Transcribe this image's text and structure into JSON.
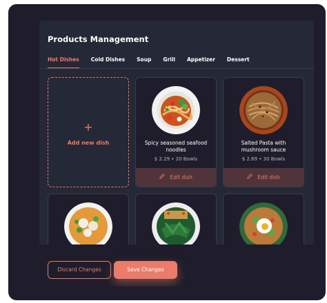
{
  "header": {
    "title": "Products Management"
  },
  "tabs": [
    {
      "label": "Hot Dishes",
      "active": true
    },
    {
      "label": "Cold Dishes",
      "active": false
    },
    {
      "label": "Soup",
      "active": false
    },
    {
      "label": "Grill",
      "active": false
    },
    {
      "label": "Appetizer",
      "active": false
    },
    {
      "label": "Dessert",
      "active": false
    }
  ],
  "add_card": {
    "plus": "+",
    "label": "Add new dish"
  },
  "dishes": [
    {
      "name": "Spicy seasoned seafood noodles",
      "price": "$ 2.29",
      "separator": "•",
      "stock": "20 Bowls",
      "edit_label": "Edit dish"
    },
    {
      "name": "Salted Pasta with mushroom sauce",
      "price": "$ 2.69",
      "separator": "•",
      "stock": "30 Bowls",
      "edit_label": "Edit dish"
    }
  ],
  "footer": {
    "discard_label": "Discard Changes",
    "save_label": "Save Changes"
  },
  "colors": {
    "accent": "#ea7c69",
    "background": "#1f1d2b",
    "panel": "#252836",
    "border": "#393c49",
    "muted": "#abbbc2"
  }
}
